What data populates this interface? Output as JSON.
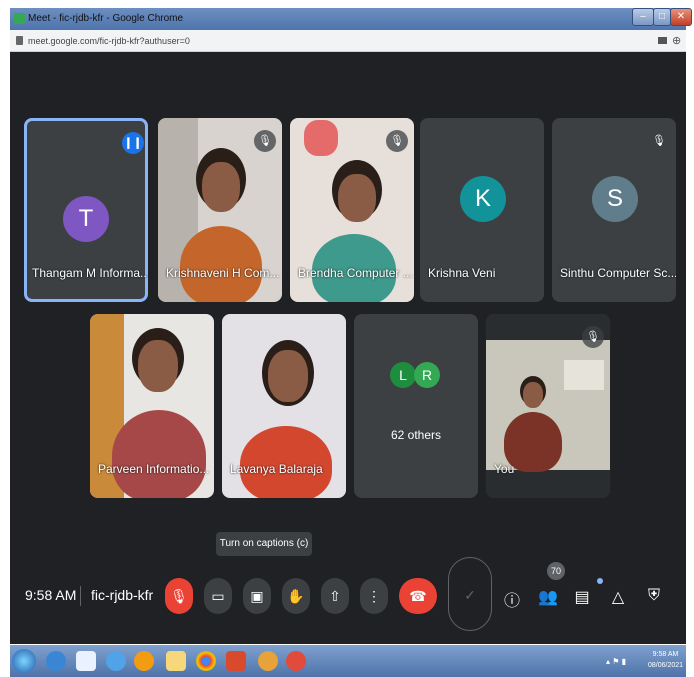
{
  "browser": {
    "title": "Meet - fic-rjdb-kfr - Google Chrome",
    "url": "meet.google.com/fic-rjdb-kfr?authuser=0"
  },
  "tiles": [
    {
      "name": "Thangam M Informa...",
      "initial": "T",
      "avatar_color": "#7e57c2"
    },
    {
      "name": "Krishnaveni H Com..."
    },
    {
      "name": "Brendha Computer ..."
    },
    {
      "name": "Krishna Veni",
      "initial": "K",
      "avatar_color": "#12939a"
    },
    {
      "name": "Sinthu Computer Sc...",
      "initial": "S",
      "avatar_color": "#607d8b"
    },
    {
      "name": "Parveen Informatio..."
    },
    {
      "name": "Lavanya Balaraja"
    },
    {
      "name": "62 others",
      "initials": [
        "L",
        "R"
      ],
      "colors": [
        "#1e8e3e",
        "#34a853"
      ]
    },
    {
      "name": "You"
    }
  ],
  "tooltip": "Turn on captions (c)",
  "controls": {
    "time": "9:58 AM",
    "meeting_code": "fic-rjdb-kfr",
    "participants_count": "70"
  },
  "taskbar": {
    "time": "9:58 AM",
    "date": "08/06/2021"
  }
}
